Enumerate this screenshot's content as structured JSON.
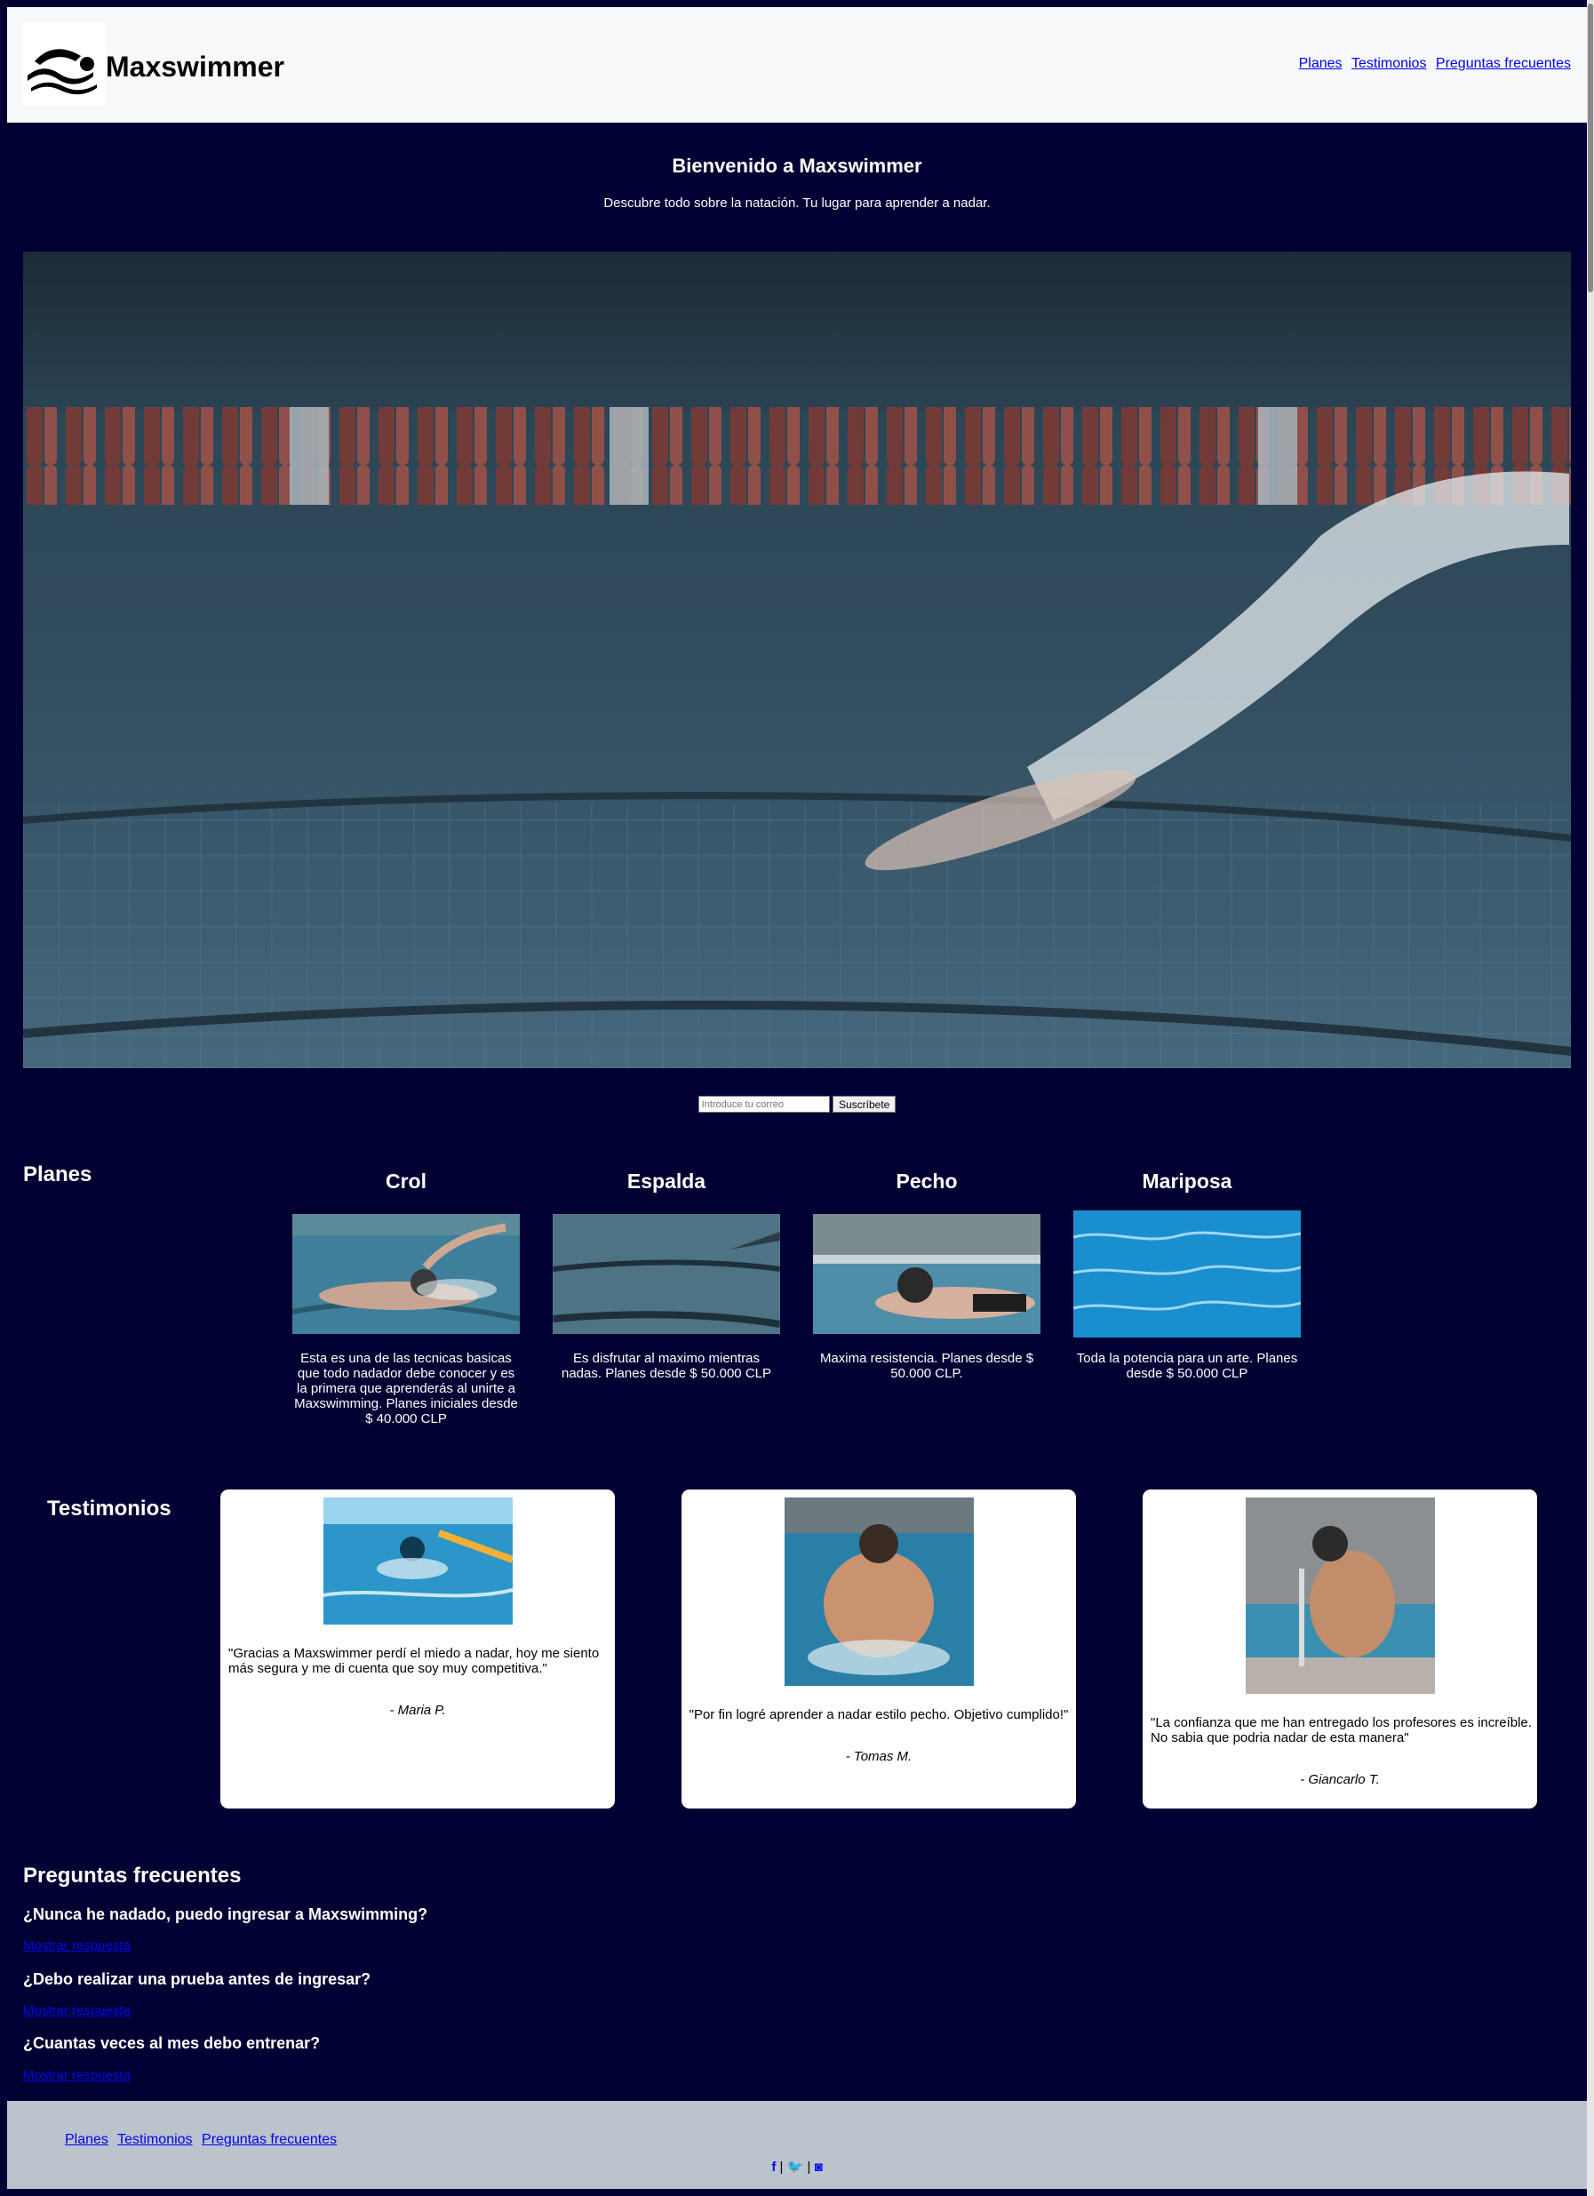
{
  "header": {
    "brand": "Maxswimmer",
    "nav": [
      "Planes",
      "Testimonios",
      "Preguntas frecuentes"
    ]
  },
  "hero": {
    "title": "Bienvenido a Maxswimmer",
    "subtitle": "Descubre todo sobre la natación. Tu lugar para aprender a nadar."
  },
  "subscribe": {
    "placeholder": "Introduce tu correo",
    "button": "Suscríbete"
  },
  "plans": {
    "title": "Planes",
    "items": [
      {
        "name": "Crol",
        "text": "Esta es una de las tecnicas basicas que todo nadador debe conocer y es la primera que aprenderás al unirte a Maxswimming. Planes iniciales desde $ 40.000 CLP"
      },
      {
        "name": "Espalda",
        "text": "Es disfrutar al maximo mientras nadas. Planes desde $ 50.000 CLP"
      },
      {
        "name": "Pecho",
        "text": "Maxima resistencia. Planes desde $ 50.000 CLP."
      },
      {
        "name": "Mariposa",
        "text": "Toda la potencia para un arte. Planes desde $ 50.000 CLP"
      }
    ]
  },
  "testimonials": {
    "title": "Testimonios",
    "items": [
      {
        "quote": "\"Gracias a Maxswimmer perdí el miedo a nadar, hoy me siento más segura y me di cuenta que soy muy competitiva.\"",
        "author": "- Maria P."
      },
      {
        "quote": "\"Por fin logré aprender a nadar estilo pecho. Objetivo cumplido!\"",
        "author": "- Tomas M."
      },
      {
        "quote": "\"La confianza que me han entregado los profesores es increíble. No sabia que podria nadar de esta manera\"",
        "author": "- Giancarlo T."
      }
    ]
  },
  "faq": {
    "title": "Preguntas frecuentes",
    "items": [
      {
        "question": "¿Nunca he nadado, puedo ingresar a Maxswimming?",
        "link": "Mostrar respuesta"
      },
      {
        "question": "¿Debo realizar una prueba antes de ingresar?",
        "link": "Mostrar respuesta"
      },
      {
        "question": "¿Cuantas veces al mes debo entrenar?",
        "link": "Mostrar respuesta"
      }
    ]
  },
  "footer": {
    "nav": [
      "Planes",
      "Testimonios",
      "Preguntas frecuentes"
    ],
    "separator": "|",
    "social": [
      {
        "icon": "facebook-icon",
        "glyph": "f"
      },
      {
        "icon": "twitter-icon",
        "glyph": "🐦"
      },
      {
        "icon": "instagram-icon",
        "glyph": "◙"
      }
    ]
  },
  "colors": {
    "page_bg": "#000033",
    "header_bg": "#f8f9fa",
    "footer_bg": "#bbc3cc",
    "link": "#0000ee"
  }
}
